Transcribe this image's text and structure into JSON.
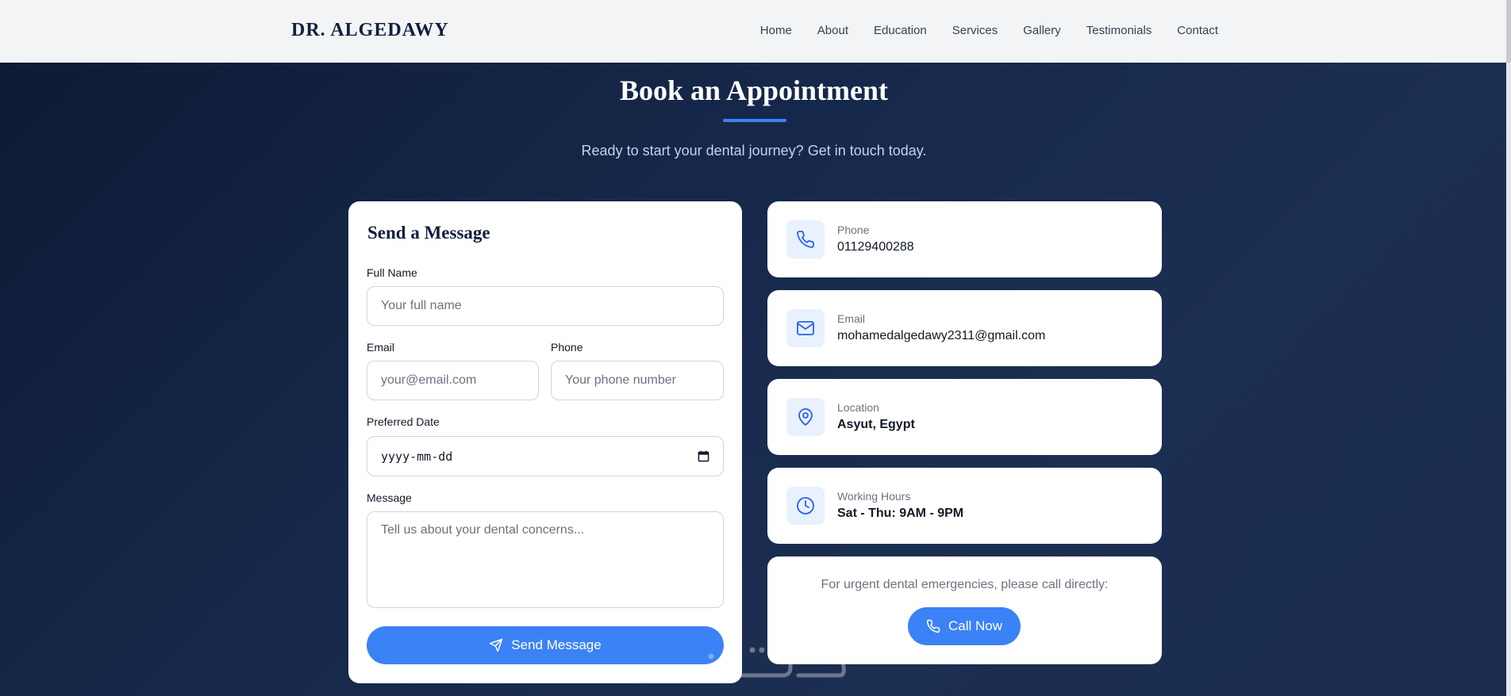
{
  "navbar": {
    "logo": "DR. ALGEDAWY",
    "links": [
      "Home",
      "About",
      "Education",
      "Services",
      "Gallery",
      "Testimonials",
      "Contact"
    ]
  },
  "section": {
    "title": "Book an Appointment",
    "subtitle": "Ready to start your dental journey? Get in touch today."
  },
  "form": {
    "title": "Send a Message",
    "full_name": {
      "label": "Full Name",
      "placeholder": "Your full name"
    },
    "email": {
      "label": "Email",
      "placeholder": "your@email.com"
    },
    "phone": {
      "label": "Phone",
      "placeholder": "Your phone number"
    },
    "date": {
      "label": "Preferred Date",
      "placeholder": "yyyy-mm-dd"
    },
    "message": {
      "label": "Message",
      "placeholder": "Tell us about your dental concerns..."
    },
    "submit_label": "Send Message"
  },
  "contact_info": [
    {
      "icon": "phone-icon",
      "label": "Phone",
      "value": "01129400288"
    },
    {
      "icon": "mail-icon",
      "label": "Email",
      "value": "mohamedalgedawy2311@gmail.com"
    },
    {
      "icon": "map-pin-icon",
      "label": "Location",
      "value": "Asyut, Egypt"
    },
    {
      "icon": "clock-icon",
      "label": "Working Hours",
      "value": "Sat - Thu: 9AM - 9PM"
    }
  ],
  "urgent": {
    "text": "For urgent dental emergencies, please call directly:",
    "button_label": "Call Now"
  },
  "colors": {
    "accent": "#3b82f6",
    "navy": "#0f1f3d",
    "icon_bg": "#e8f1fd"
  }
}
